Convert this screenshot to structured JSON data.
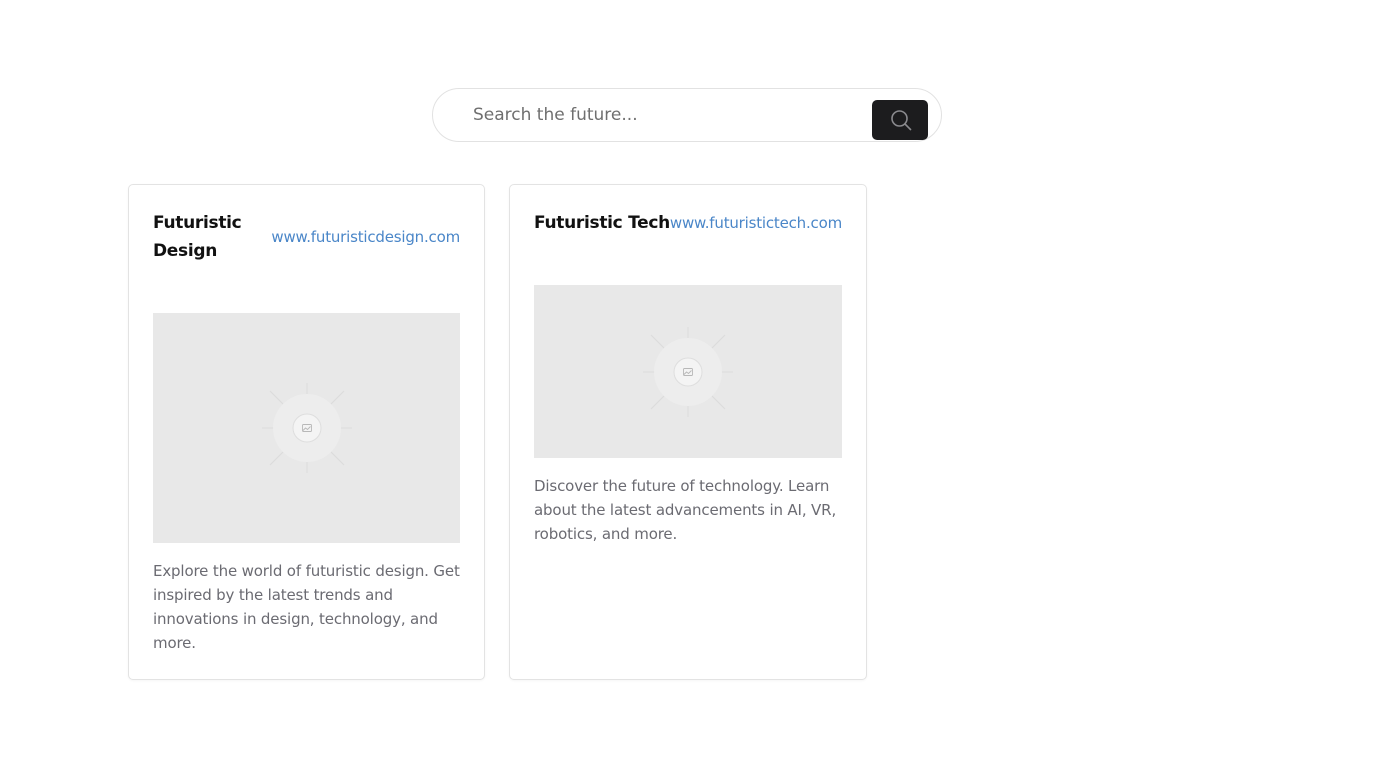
{
  "search": {
    "placeholder": "Search the future...",
    "value": "",
    "button_icon": "search-icon"
  },
  "cards": [
    {
      "title": "Futuristic Design",
      "link": "www.futuristicdesign.com",
      "image_icon": "image-placeholder-icon",
      "description": "Explore the world of futuristic design. Get inspired by the latest trends and innovations in design, technology, and more."
    },
    {
      "title": "Futuristic Tech",
      "link": "www.futuristictech.com",
      "image_icon": "image-placeholder-icon",
      "description": "Discover the future of technology. Learn about the latest advancements in AI, VR, robotics, and more."
    }
  ],
  "colors": {
    "link": "#4a86c8",
    "button": "#1c1c1e",
    "image_placeholder": "#e8e8e8"
  }
}
